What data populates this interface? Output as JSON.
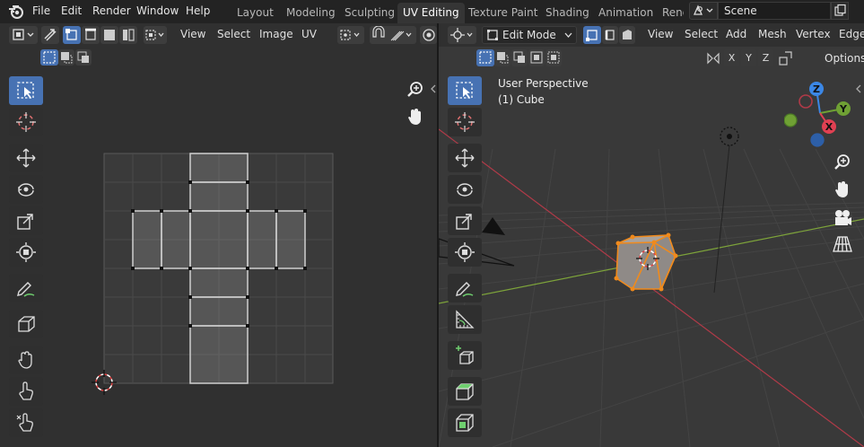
{
  "menubar": {
    "items": [
      "File",
      "Edit",
      "Render",
      "Window",
      "Help"
    ]
  },
  "workspaces": {
    "tabs": [
      "Layout",
      "Modeling",
      "Sculpting",
      "UV Editing",
      "Texture Paint",
      "Shading",
      "Animation",
      "Rend"
    ],
    "active_index": 3
  },
  "scene": {
    "name": "Scene"
  },
  "uv_editor": {
    "menu": [
      "View",
      "Select",
      "Image",
      "UV"
    ]
  },
  "viewport": {
    "mode": "Edit Mode",
    "menu": [
      "View",
      "Select",
      "Add",
      "Mesh",
      "Vertex",
      "Edge"
    ],
    "overlay_title": "User Perspective",
    "overlay_object": "(1) Cube",
    "axes": [
      "X",
      "Y",
      "Z"
    ],
    "options_label": "Options",
    "gizmo_labels": {
      "x": "X",
      "y": "Y",
      "z": "Z"
    }
  },
  "colors": {
    "accent": "#4772b3",
    "selection_orange": "#f08a1c",
    "x_axis": "#e04052",
    "y_axis": "#6fa034",
    "z_axis": "#3b87e6"
  }
}
